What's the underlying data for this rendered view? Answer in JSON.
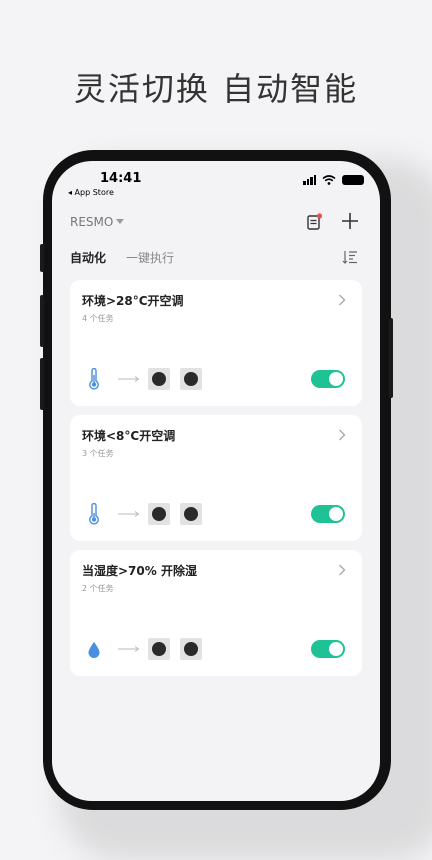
{
  "headline": "灵活切换 自动智能",
  "status_bar": {
    "time": "14:41",
    "back_label": "◂ App Store"
  },
  "nav": {
    "home_name": "RESMO"
  },
  "tabs": [
    {
      "label": "自动化"
    },
    {
      "label": "一键执行"
    }
  ],
  "automations": [
    {
      "title": "环境>28°C开空调",
      "subtitle": "4 个任务",
      "condition_icon": "thermometer-icon",
      "enabled": true
    },
    {
      "title": "环境<8°C开空调",
      "subtitle": "3 个任务",
      "condition_icon": "thermometer-icon",
      "enabled": true
    },
    {
      "title": "当湿度>70% 开除湿",
      "subtitle": "2 个任务",
      "condition_icon": "water-drop-icon",
      "enabled": true
    }
  ],
  "colors": {
    "accent": "#1ec295",
    "condition_icon": "#4a8fe0",
    "notification_dot": "#f04b4b"
  }
}
